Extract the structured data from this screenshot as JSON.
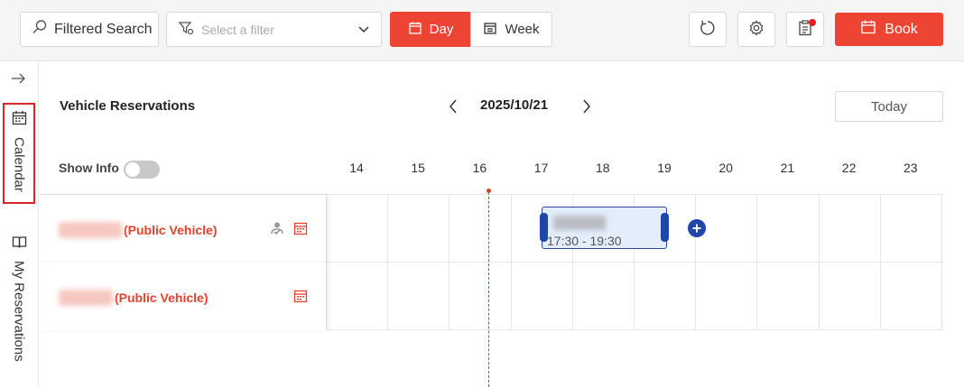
{
  "toolbar": {
    "search_label": "Filtered Search",
    "filter_placeholder": "Select a filter",
    "view_day": "Day",
    "view_week": "Week",
    "book_label": "Book",
    "active_view": "Day",
    "accent_color": "#ee4433"
  },
  "sidebar": {
    "tabs": [
      {
        "label": "Calendar",
        "icon": "calendar-icon",
        "active": true
      },
      {
        "label": "My Reservations",
        "icon": "book-icon",
        "active": false
      }
    ]
  },
  "main": {
    "title": "Vehicle Reservations",
    "date": "2025/10/21",
    "today_label": "Today",
    "show_info_label": "Show Info",
    "show_info_on": false,
    "hours": [
      "14",
      "15",
      "16",
      "17",
      "18",
      "19",
      "20",
      "21",
      "22",
      "23"
    ],
    "current_time_hour": 16.15,
    "rows": [
      {
        "name_suffix": "(Public Vehicle)",
        "icons": [
          "person-check-icon",
          "calendar-icon"
        ]
      },
      {
        "name_suffix": "(Public Vehicle)",
        "icons": [
          "calendar-icon"
        ]
      }
    ],
    "booking": {
      "time": "17:30 - 19:30",
      "row": 0,
      "start_hour": 17.5,
      "end_hour": 19.5
    }
  }
}
